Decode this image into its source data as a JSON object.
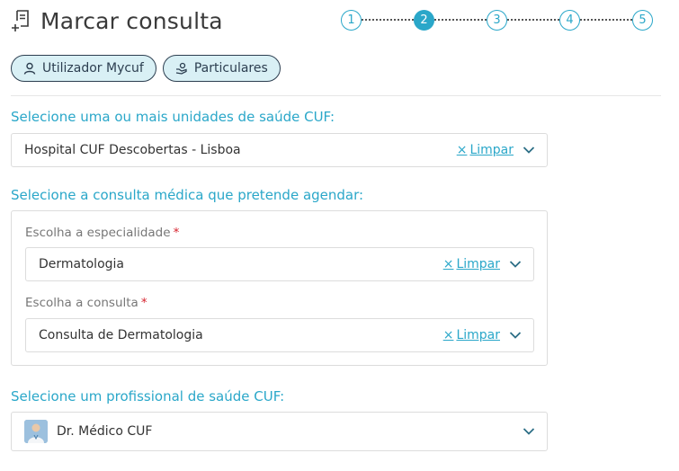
{
  "header": {
    "title": "Marcar consulta",
    "icon": "add-document-icon"
  },
  "stepper": {
    "steps": [
      "1",
      "2",
      "3",
      "4",
      "5"
    ],
    "active_step": 2
  },
  "chips": [
    {
      "label": "Utilizador Mycuf",
      "icon": "user-icon"
    },
    {
      "label": "Particulares",
      "icon": "hand-coin-icon"
    }
  ],
  "units": {
    "label": "Selecione uma ou mais unidades de saúde CUF:",
    "value": "Hospital CUF Descobertas - Lisboa",
    "clear_label": "Limpar"
  },
  "consultation": {
    "label": "Selecione a consulta médica que pretende agendar:",
    "specialty": {
      "label": "Escolha a especialidade",
      "required": "*",
      "value": "Dermatologia",
      "clear_label": "Limpar"
    },
    "consult": {
      "label": "Escolha a consulta",
      "required": "*",
      "value": "Consulta de Dermatologia",
      "clear_label": "Limpar"
    }
  },
  "professional": {
    "label": "Selecione um profissional de saúde CUF:",
    "value": "Dr. Médico CUF"
  },
  "colors": {
    "accent": "#2aa7c9",
    "chip_bg": "#d9f0f5",
    "required": "#d6232e"
  }
}
